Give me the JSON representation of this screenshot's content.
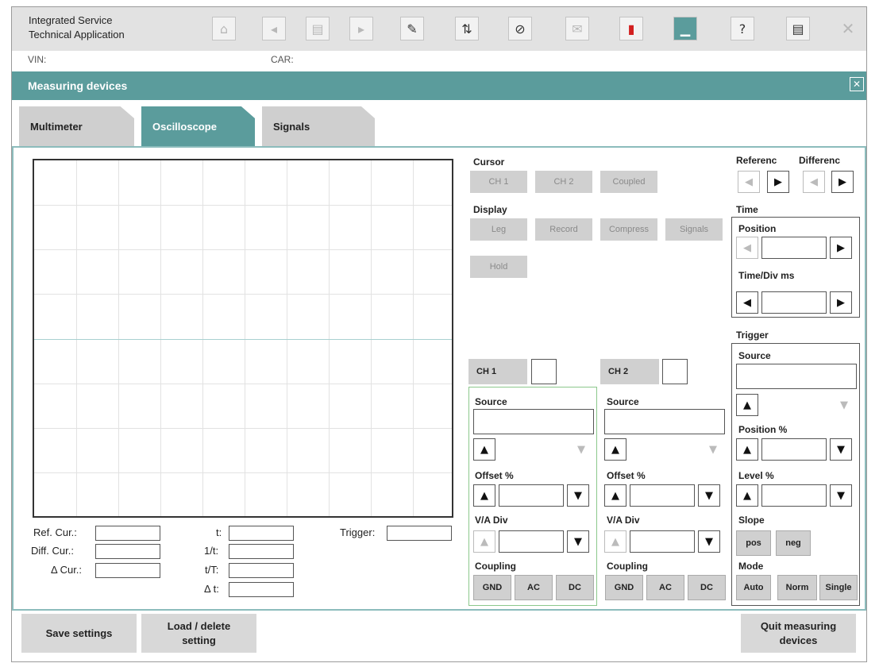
{
  "app": {
    "title_line1": "Integrated Service",
    "title_line2": "Technical Application",
    "vin_label": "VIN:",
    "car_label": "CAR:",
    "section_title": "Measuring devices",
    "close_glyph": "✕"
  },
  "toolbar_icons": [
    "home-icon",
    "back-icon",
    "document-icon",
    "forward-icon",
    "wrench-icon",
    "transfer-icon",
    "diagnostic-plug-icon",
    "mail-icon",
    "battery-icon",
    "measure-icon",
    "help-icon",
    "list-icon",
    "close-icon"
  ],
  "tabs": {
    "multimeter": "Multimeter",
    "oscilloscope": "Oscilloscope",
    "signals": "Signals"
  },
  "readouts": {
    "ref_cur": "Ref. Cur.:",
    "diff_cur": "Diff. Cur.:",
    "delta_cur": "Δ Cur.:",
    "t": "t:",
    "inv_t": "1/t:",
    "t_over_T": "t/T:",
    "delta_t": "Δ t:",
    "trigger": "Trigger:"
  },
  "cursor": {
    "label": "Cursor",
    "ch1": "CH 1",
    "ch2": "CH 2",
    "coupled": "Coupled"
  },
  "display": {
    "label": "Display",
    "leg": "Leg",
    "record": "Record",
    "compress": "Compress",
    "signals": "Signals",
    "hold": "Hold"
  },
  "reference": {
    "ref_label": "Referenc",
    "diff_label": "Differenc"
  },
  "time": {
    "label": "Time",
    "position": "Position",
    "timediv": "Time/Div ms"
  },
  "ch1": {
    "label": "CH 1",
    "source": "Source",
    "offset": "Offset  %",
    "vadiv": "V/A Div",
    "coupling": "Coupling",
    "gnd": "GND",
    "ac": "AC",
    "dc": "DC"
  },
  "ch2": {
    "label": "CH 2",
    "source": "Source",
    "offset": "Offset  %",
    "vadiv": "V/A Div",
    "coupling": "Coupling",
    "gnd": "GND",
    "ac": "AC",
    "dc": "DC"
  },
  "trigger": {
    "label": "Trigger",
    "source": "Source",
    "position": "Position  %",
    "level": "Level  %",
    "slope": "Slope",
    "pos": "pos",
    "neg": "neg",
    "mode": "Mode",
    "auto": "Auto",
    "norm": "Norm",
    "single": "Single"
  },
  "bottom": {
    "save": "Save settings",
    "load": "Load / delete setting",
    "quit": "Quit measuring devices"
  },
  "colors": {
    "accent": "#5b9c9c",
    "panel_border": "#8cbcbc"
  }
}
